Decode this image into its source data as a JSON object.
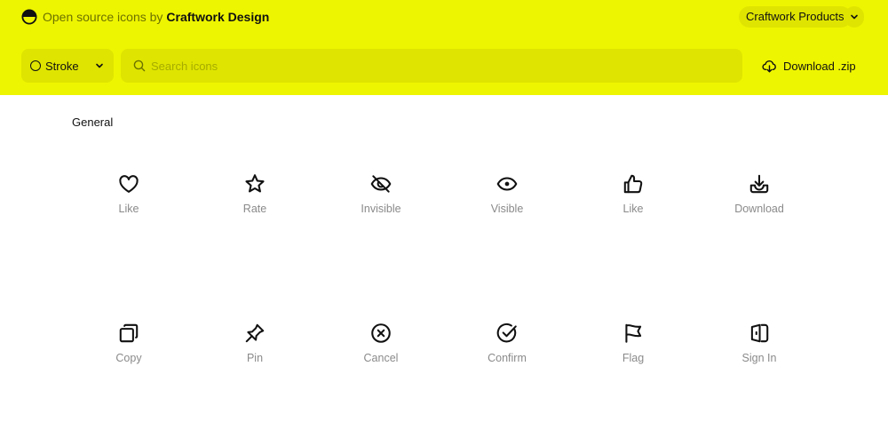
{
  "header": {
    "brand_prefix": "Open source icons by",
    "brand_name": "Craftwork Design",
    "products_label": "Craftwork Products",
    "style_label": "Stroke",
    "search_placeholder": "Search icons",
    "download_label": "Download .zip",
    "accent_color": "#eef500"
  },
  "section": {
    "title": "General"
  },
  "icons": [
    {
      "label": "Like",
      "icon": "heart-icon"
    },
    {
      "label": "Rate",
      "icon": "star-icon"
    },
    {
      "label": "Invisible",
      "icon": "eye-off-icon"
    },
    {
      "label": "Visible",
      "icon": "eye-icon"
    },
    {
      "label": "Like",
      "icon": "thumbs-up-icon"
    },
    {
      "label": "Download",
      "icon": "download-tray-icon"
    },
    {
      "label": "Copy",
      "icon": "copy-icon"
    },
    {
      "label": "Pin",
      "icon": "pin-icon"
    },
    {
      "label": "Cancel",
      "icon": "cancel-circle-icon"
    },
    {
      "label": "Confirm",
      "icon": "confirm-circle-icon"
    },
    {
      "label": "Flag",
      "icon": "flag-icon"
    },
    {
      "label": "Sign In",
      "icon": "sign-in-icon"
    }
  ]
}
